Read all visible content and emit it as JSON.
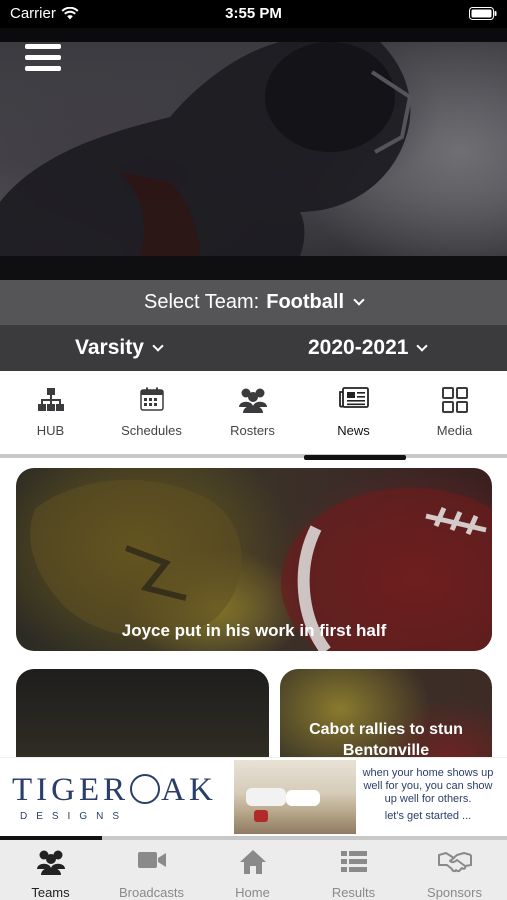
{
  "status_bar": {
    "carrier": "Carrier",
    "time": "3:55 PM"
  },
  "team_select": {
    "label": "Select Team:",
    "value": "Football"
  },
  "filters": {
    "level": "Varsity",
    "season": "2020-2021"
  },
  "subtabs": [
    {
      "label": "HUB",
      "icon": "org-chart-icon"
    },
    {
      "label": "Schedules",
      "icon": "calendar-icon"
    },
    {
      "label": "Rosters",
      "icon": "group-icon"
    },
    {
      "label": "News",
      "icon": "newspaper-icon"
    },
    {
      "label": "Media",
      "icon": "grid-icon"
    }
  ],
  "active_subtab": "News",
  "news": [
    {
      "title": "Joyce put in his work in first half"
    },
    {
      "title": ""
    },
    {
      "title": "Cabot rallies to stun Bentonville"
    }
  ],
  "ad": {
    "brand": "TIGEROAK",
    "sub": "DESIGNS",
    "text": "when your home shows up well for you, you can show up well for others.",
    "cta": "let's get started ..."
  },
  "bottom_nav": [
    {
      "label": "Teams",
      "icon": "teams-icon"
    },
    {
      "label": "Broadcasts",
      "icon": "video-camera-icon"
    },
    {
      "label": "Home",
      "icon": "home-icon"
    },
    {
      "label": "Results",
      "icon": "list-icon"
    },
    {
      "label": "Sponsors",
      "icon": "handshake-icon"
    }
  ],
  "active_nav": "Teams",
  "colors": {
    "team_bar": "#555557",
    "filter_bar": "#3b3b3d",
    "nav_bg": "#ececec",
    "brand_navy": "#2a3e6b"
  }
}
